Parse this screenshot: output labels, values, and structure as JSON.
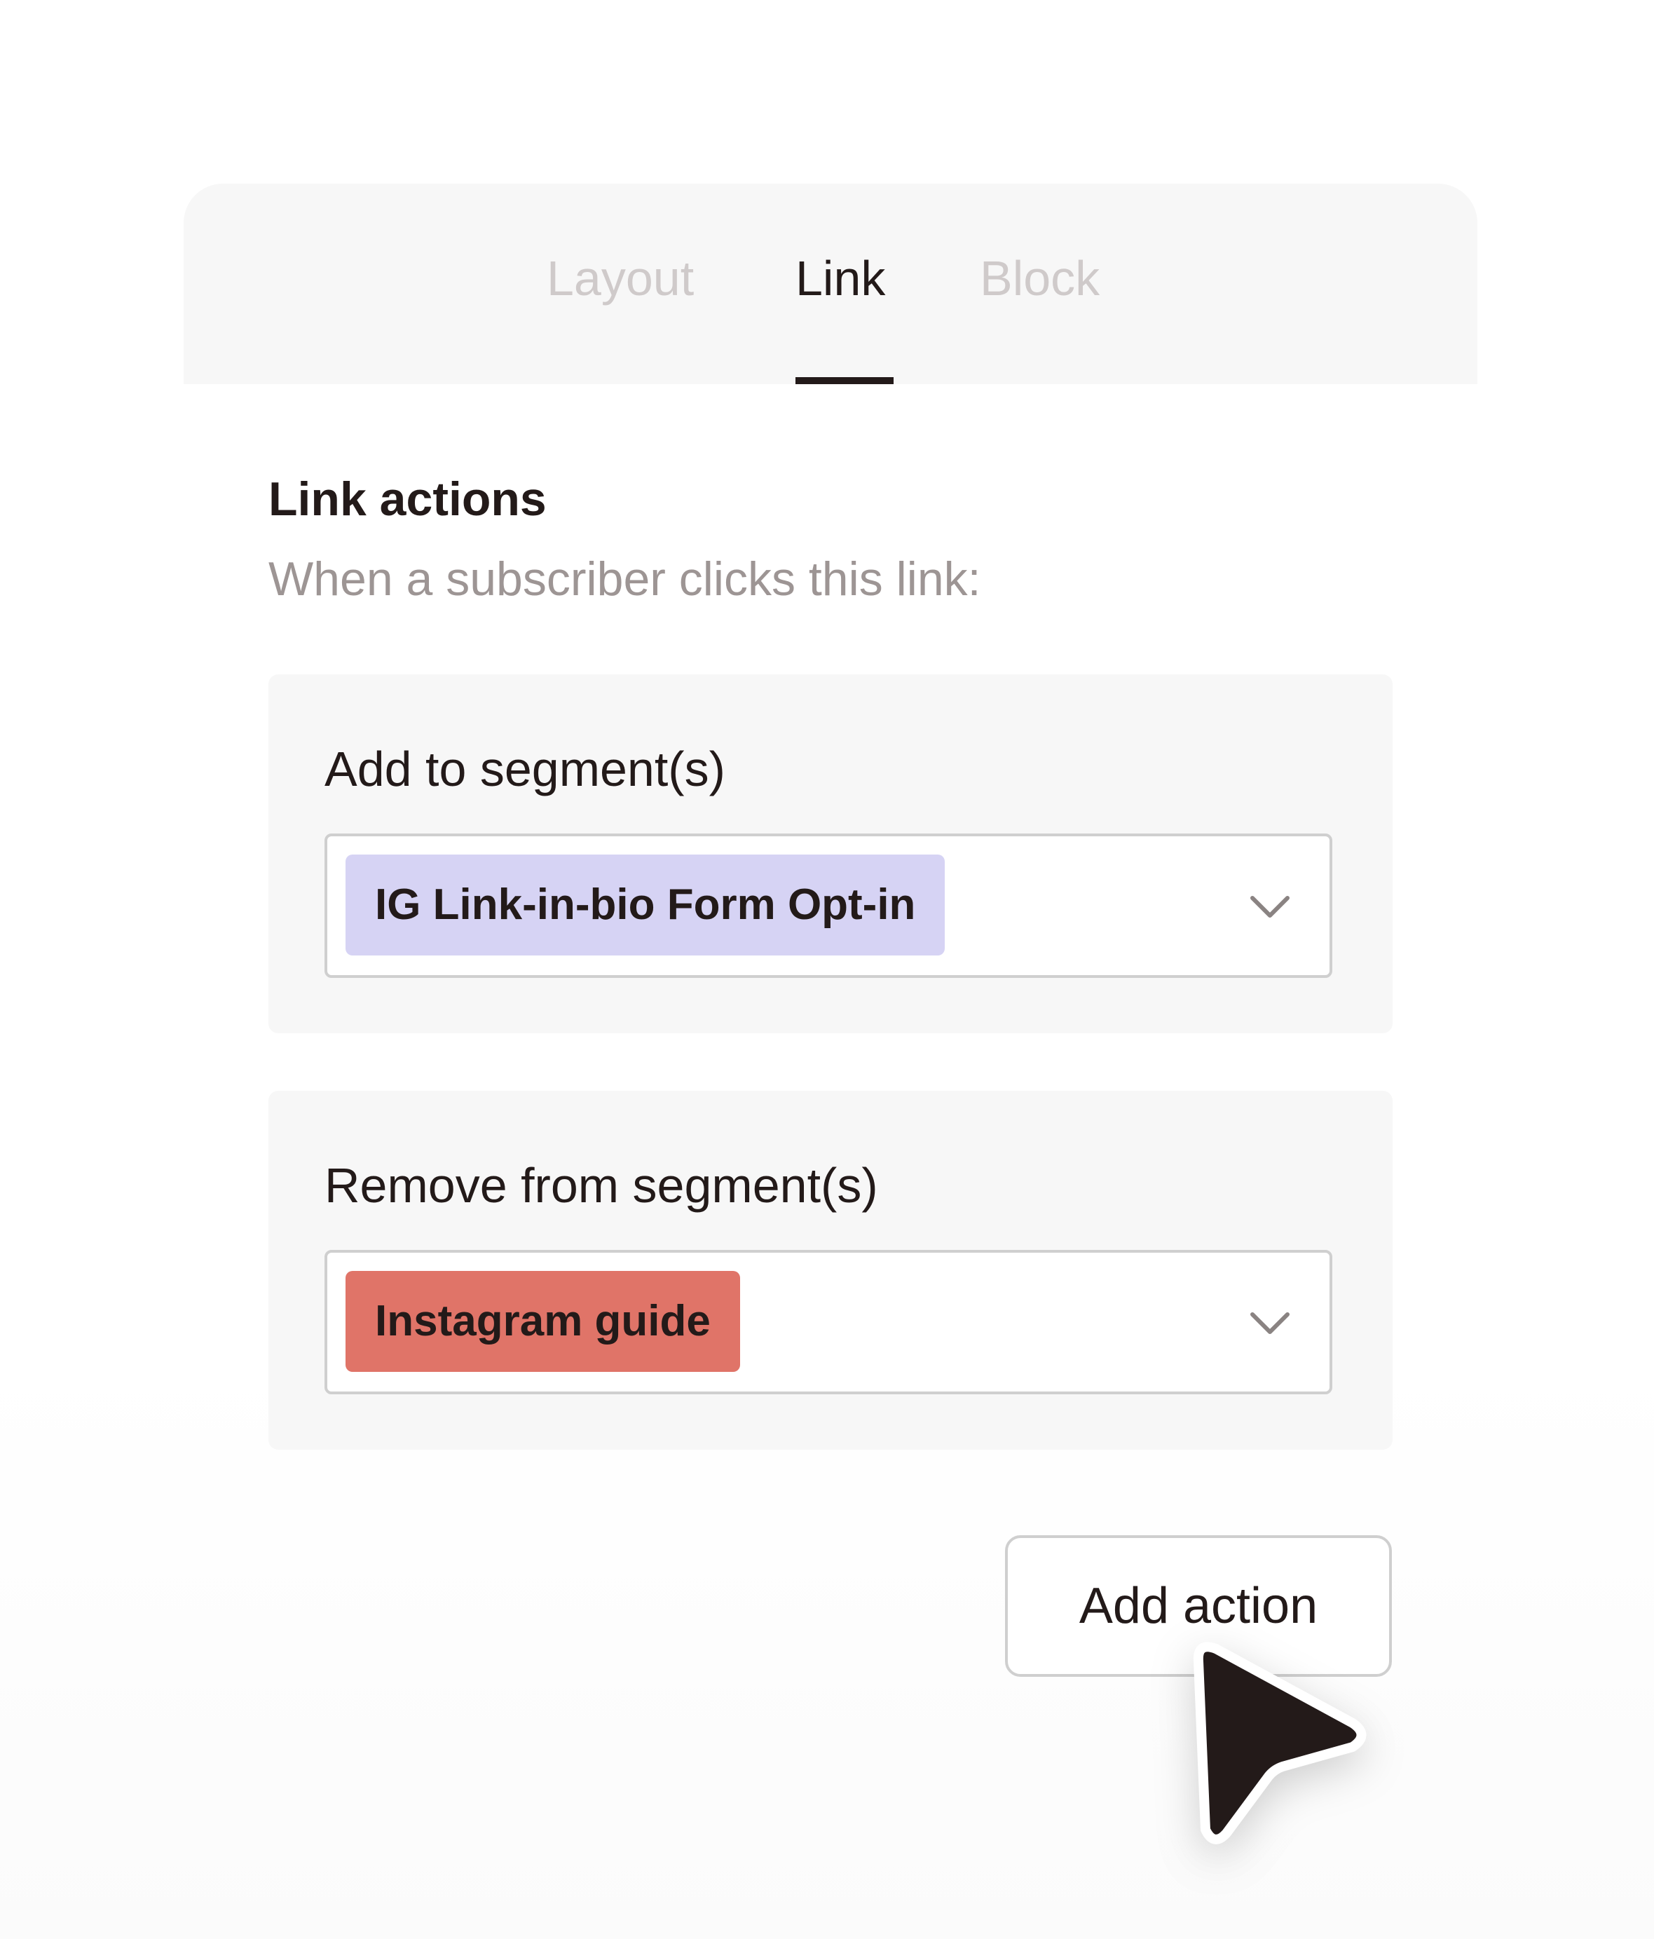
{
  "tabs": [
    {
      "label": "Layout",
      "active": false
    },
    {
      "label": "Link",
      "active": true
    },
    {
      "label": "Block",
      "active": false
    }
  ],
  "section": {
    "title": "Link actions",
    "subtitle": "When a subscriber clicks this link:"
  },
  "actions": [
    {
      "label": "Add to segment(s)",
      "selected_segment": "IG Link-in-bio Form Opt-in",
      "chip_color": "#d6d3f4"
    },
    {
      "label": "Remove from segment(s)",
      "selected_segment": "Instagram guide",
      "chip_color": "#e07468"
    }
  ],
  "add_action_label": "Add action",
  "icons": {
    "dropdown": "chevron-down-icon",
    "cursor": "mouse-pointer-icon"
  },
  "colors": {
    "text_primary": "#231a19",
    "text_muted": "#9d9594",
    "tab_inactive": "#cfcaca",
    "panel_bg": "#f7f7f7"
  }
}
